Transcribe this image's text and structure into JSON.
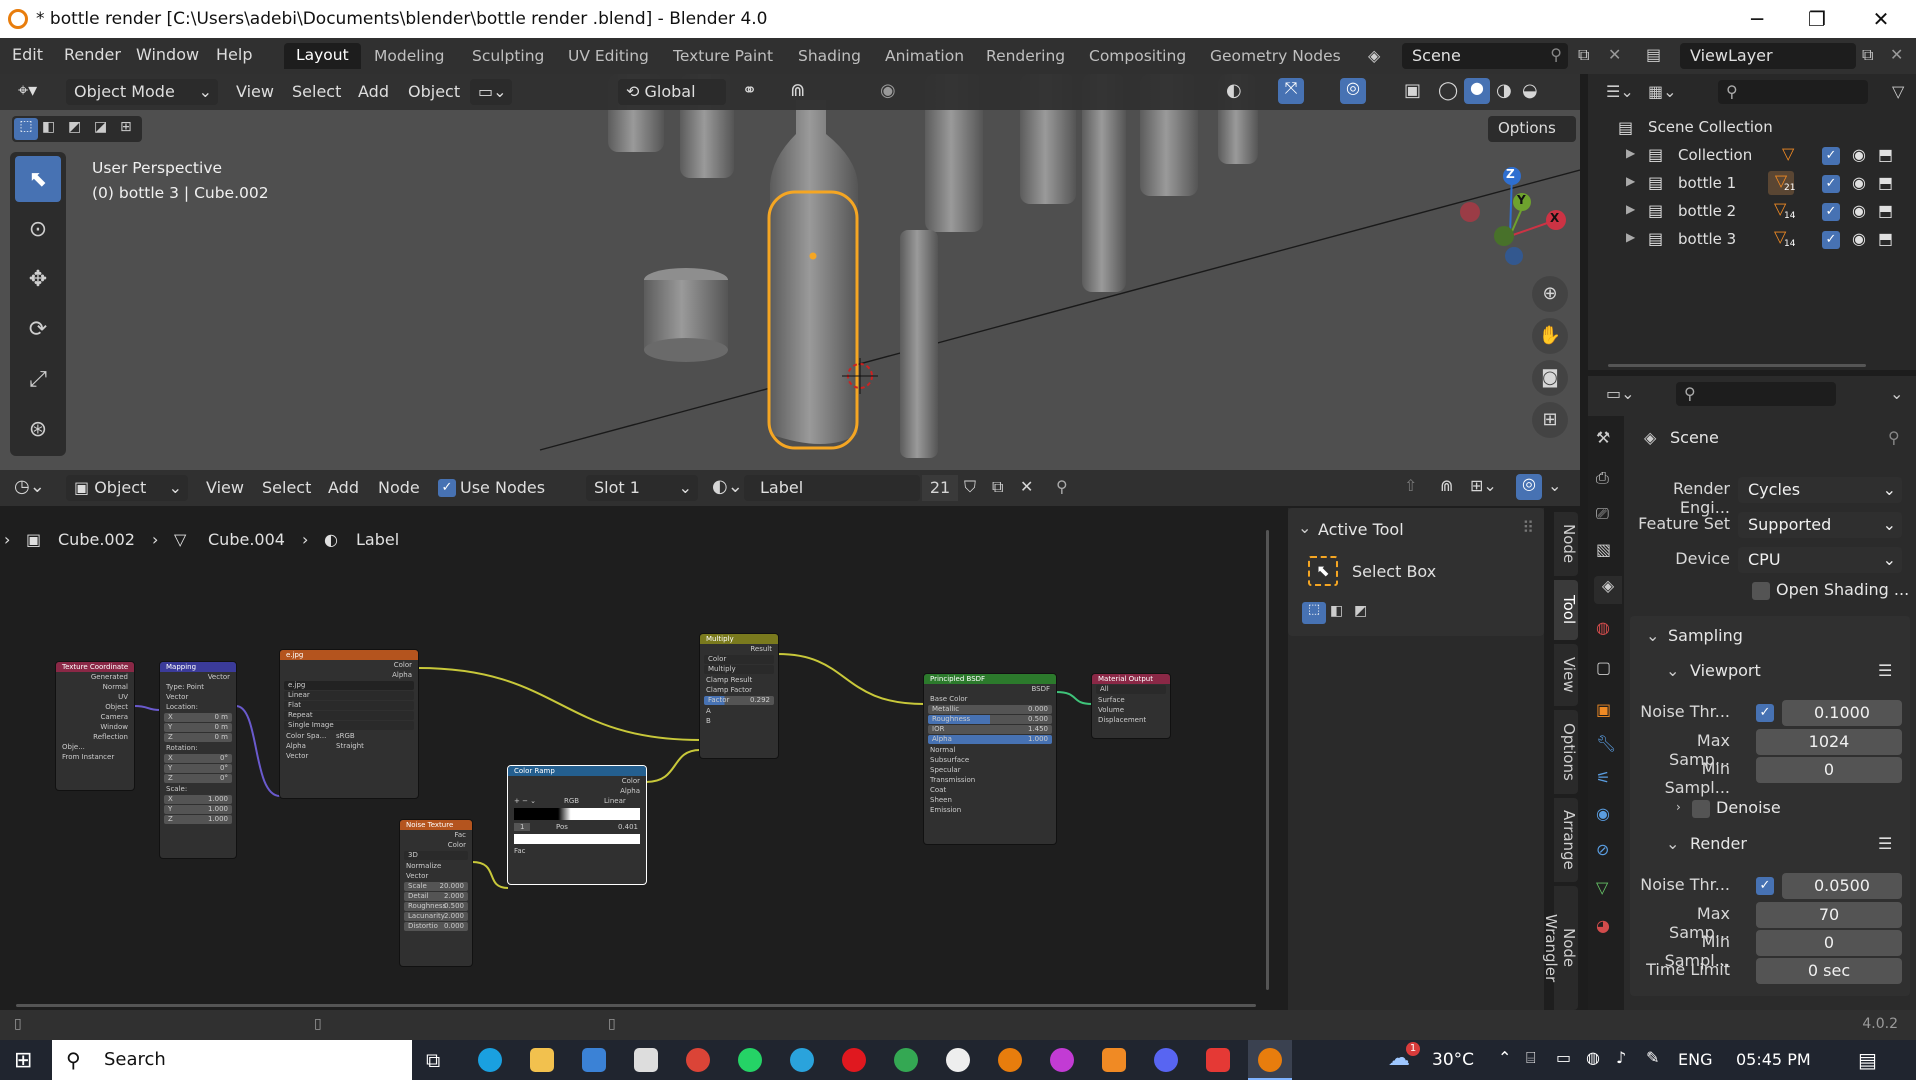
{
  "window": {
    "title": "* bottle render  [C:\\Users\\adebi\\Documents\\blender\\bottle render .blend] - Blender 4.0",
    "min": "─",
    "max": "❐",
    "close": "✕"
  },
  "menus": [
    "Edit",
    "Render",
    "Window",
    "Help"
  ],
  "workspaces": [
    "Layout",
    "Modeling",
    "Sculpting",
    "UV Editing",
    "Texture Paint",
    "Shading",
    "Animation",
    "Rendering",
    "Compositing",
    "Geometry Nodes"
  ],
  "scene_field": "Scene",
  "viewlayer_field": "ViewLayer",
  "viewport": {
    "mode": "Object Mode",
    "menus": [
      "View",
      "Select",
      "Add",
      "Object"
    ],
    "orientation": "Global",
    "options": "Options",
    "info_line1": "User Perspective",
    "info_line2": "(0) bottle 3  | Cube.002",
    "gizmo": {
      "z": "Z",
      "y": "Y",
      "x": "X"
    }
  },
  "outliner": {
    "root": "Scene Collection",
    "items": [
      {
        "name": "Collection",
        "badge": ""
      },
      {
        "name": "bottle 1",
        "badge": "21"
      },
      {
        "name": "bottle 2",
        "badge": "14"
      },
      {
        "name": "bottle 3",
        "badge": "14"
      }
    ]
  },
  "node_editor": {
    "type": "Object",
    "menus": [
      "View",
      "Select",
      "Add",
      "Node"
    ],
    "use_nodes": "Use Nodes",
    "slot": "Slot 1",
    "material": "Label",
    "users": "21",
    "breadcrumb": [
      "Cube.002",
      "Cube.004",
      "Label"
    ],
    "nodes": {
      "texcoord": {
        "title": "Texture Coordinate",
        "outputs": [
          "Generated",
          "Normal",
          "UV",
          "Object",
          "Camera",
          "Window",
          "Reflection"
        ],
        "obj": "Obje...",
        "from": "From Instancer"
      },
      "mapping": {
        "title": "Mapping",
        "out": "Vector",
        "type_label": "Type:",
        "type": "Point",
        "vector": "Vector",
        "location": "Location:",
        "loc": [
          "X",
          "0 m",
          "Y",
          "0 m",
          "Z",
          "0 m"
        ],
        "rotation": "Rotation:",
        "rot": [
          "X",
          "0°",
          "Y",
          "0°",
          "Z",
          "0°"
        ],
        "scale": "Scale:",
        "scl": [
          "X",
          "1.000",
          "Y",
          "1.000",
          "Z",
          "1.000"
        ]
      },
      "image": {
        "title": "e.jpg",
        "outs": [
          "Color",
          "Alpha"
        ],
        "file": "e.jpg",
        "opts": [
          "Linear",
          "Flat",
          "Repeat",
          "Single Image"
        ],
        "cs_label": "Color Spa...",
        "cs": "sRGB",
        "alpha_label": "Alpha",
        "alpha": "Straight",
        "vector": "Vector"
      },
      "noise": {
        "title": "Noise Texture",
        "outs": [
          "Fac",
          "Color"
        ],
        "dim": "3D",
        "normalize": "Normalize",
        "vector": "Vector",
        "fields": [
          [
            "Scale",
            "20.000"
          ],
          [
            "Detail",
            "2.000"
          ],
          [
            "Roughness",
            "0.500"
          ],
          [
            "Lacunarity",
            "2.000"
          ],
          [
            "Distortio",
            "0.000"
          ]
        ]
      },
      "ramp": {
        "title": "Color Ramp",
        "outs": [
          "Color",
          "Alpha"
        ],
        "mode": "RGB",
        "interp": "Linear",
        "idx": "1",
        "pos_label": "Pos",
        "pos": "0.401",
        "fac": "Fac"
      },
      "multiply": {
        "title": "Multiply",
        "out": "Result",
        "color": "Color",
        "op": "Multiply",
        "clamp_result": "Clamp Result",
        "clamp_factor": "Clamp Factor",
        "factor_label": "Factor",
        "factor": "0.292",
        "a": "A",
        "b": "B"
      },
      "bsdf": {
        "title": "Principled BSDF",
        "out": "BSDF",
        "base": "Base Color",
        "fields": [
          [
            "Metallic",
            "0.000"
          ],
          [
            "Roughness",
            "0.500"
          ],
          [
            "IOR",
            "1.450"
          ],
          [
            "Alpha",
            "1.000"
          ]
        ],
        "normal": "Normal",
        "subs": [
          "Subsurface",
          "Specular",
          "Transmission",
          "Coat",
          "Sheen",
          "Emission"
        ]
      },
      "output": {
        "title": "Material Output",
        "target": "All",
        "ins": [
          "Surface",
          "Volume",
          "Displacement"
        ]
      }
    }
  },
  "side_panel": {
    "title": "Active Tool",
    "tool": "Select Box",
    "tabs": [
      "Node",
      "Tool",
      "View",
      "Options",
      "Arrange",
      "Node Wrangler"
    ]
  },
  "properties": {
    "scene": "Scene",
    "render_engine_label": "Render Engi...",
    "render_engine": "Cycles",
    "feature_set_label": "Feature Set",
    "feature_set": "Supported",
    "device_label": "Device",
    "device": "CPU",
    "open_shading": "Open Shading ...",
    "sampling": "Sampling",
    "viewport": "Viewport",
    "vp_noise_label": "Noise Thr...",
    "vp_noise": "0.1000",
    "vp_max_label": "Max Samp...",
    "vp_max": "1024",
    "vp_min_label": "Min Sampl...",
    "vp_min": "0",
    "denoise": "Denoise",
    "render": "Render",
    "r_noise_label": "Noise Thr...",
    "r_noise": "0.0500",
    "r_max_label": "Max Samp...",
    "r_max": "70",
    "r_min_label": "Min Sampl...",
    "r_min": "0",
    "time_label": "Time Limit",
    "time": "0 sec"
  },
  "status": {
    "version": "4.0.2"
  },
  "taskbar": {
    "search": "Search",
    "temp": "30°C",
    "lang": "ENG",
    "time": "05:45 PM",
    "notif": "1"
  }
}
